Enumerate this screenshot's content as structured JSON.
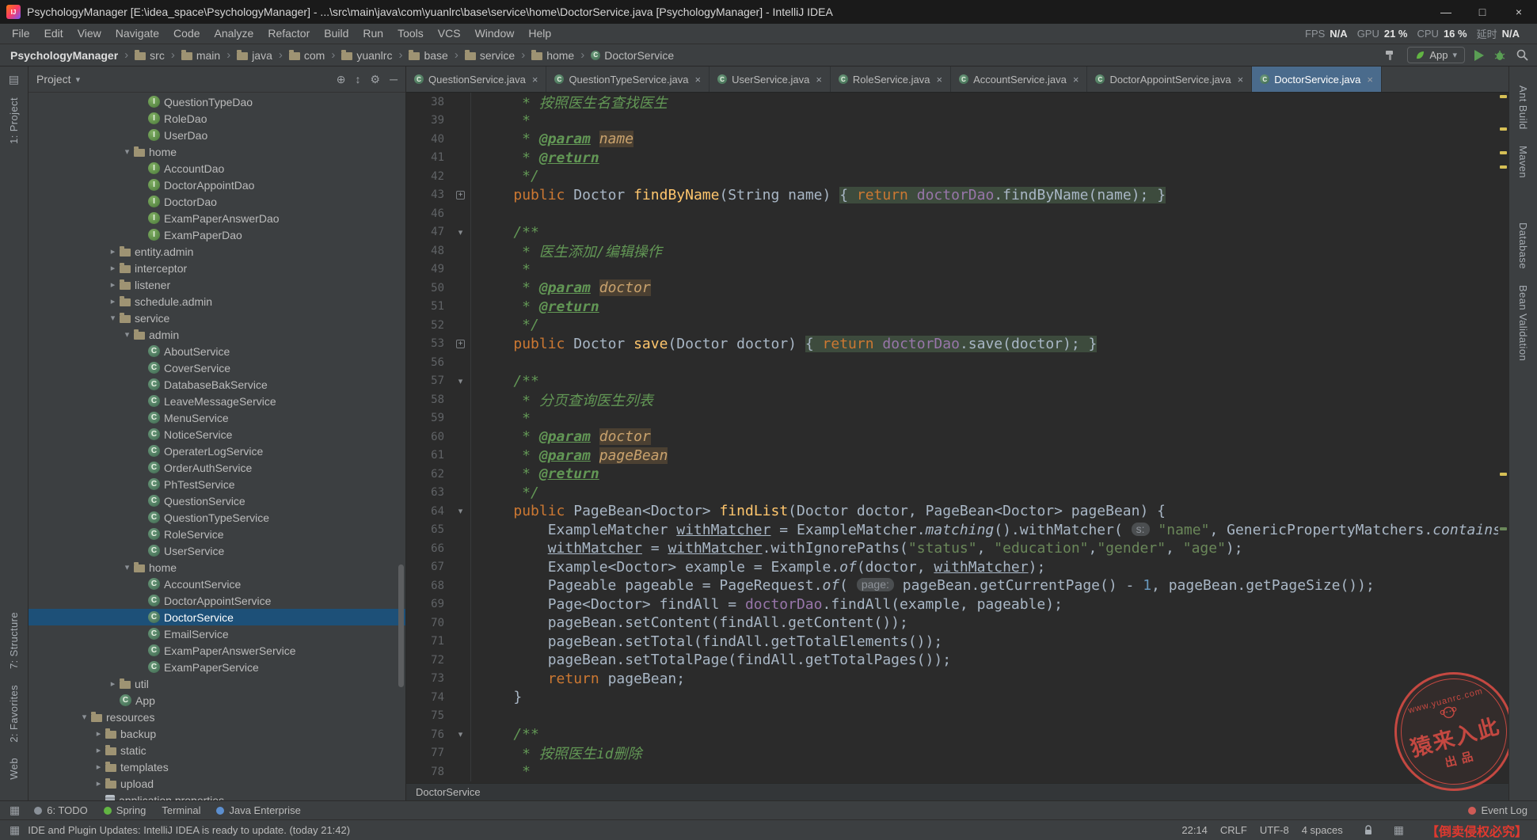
{
  "title_bar": {
    "title": "PsychologyManager [E:\\idea_space\\PsychologyManager] - ...\\src\\main\\java\\com\\yuanlrc\\base\\service\\home\\DoctorService.java [PsychologyManager] - IntelliJ IDEA",
    "window_buttons": {
      "minimize": "—",
      "maximize": "□",
      "close": "×"
    }
  },
  "menu_bar": {
    "items": [
      "File",
      "Edit",
      "View",
      "Navigate",
      "Code",
      "Analyze",
      "Refactor",
      "Build",
      "Run",
      "Tools",
      "VCS",
      "Window",
      "Help"
    ],
    "perf_stats": [
      {
        "label": "FPS",
        "value": "N/A"
      },
      {
        "label": "GPU",
        "value": "21 %"
      },
      {
        "label": "CPU",
        "value": "16 %"
      },
      {
        "label": "延时",
        "value": "N/A"
      }
    ]
  },
  "nav_bar": {
    "crumbs": [
      {
        "label": "PsychologyManager",
        "icon": "project"
      },
      {
        "label": "src",
        "icon": "folder"
      },
      {
        "label": "main",
        "icon": "folder"
      },
      {
        "label": "java",
        "icon": "folder"
      },
      {
        "label": "com",
        "icon": "folder"
      },
      {
        "label": "yuanlrc",
        "icon": "folder"
      },
      {
        "label": "base",
        "icon": "folder"
      },
      {
        "label": "service",
        "icon": "folder"
      },
      {
        "label": "home",
        "icon": "folder"
      },
      {
        "label": "DoctorService",
        "icon": "class"
      }
    ],
    "run_config": "App"
  },
  "left_stripe": {
    "top": [
      "1: Project"
    ],
    "bottom": [
      "7: Structure",
      "2: Favorites",
      "Web"
    ]
  },
  "right_stripe": {
    "groups": [
      [
        "Ant Build",
        "Maven"
      ],
      [
        "Database",
        "Bean Validation"
      ]
    ]
  },
  "project": {
    "header": "Project",
    "tree": [
      {
        "label": "QuestionTypeDao",
        "level": 7,
        "icon": "interface",
        "state": "leaf"
      },
      {
        "label": "RoleDao",
        "level": 7,
        "icon": "interface",
        "state": "leaf"
      },
      {
        "label": "UserDao",
        "level": 7,
        "icon": "interface",
        "state": "leaf"
      },
      {
        "label": "home",
        "level": 6,
        "icon": "folder",
        "state": "open"
      },
      {
        "label": "AccountDao",
        "level": 7,
        "icon": "interface",
        "state": "leaf"
      },
      {
        "label": "DoctorAppointDao",
        "level": 7,
        "icon": "interface",
        "state": "leaf"
      },
      {
        "label": "DoctorDao",
        "level": 7,
        "icon": "interface",
        "state": "leaf"
      },
      {
        "label": "ExamPaperAnswerDao",
        "level": 7,
        "icon": "interface",
        "state": "leaf"
      },
      {
        "label": "ExamPaperDao",
        "level": 7,
        "icon": "interface",
        "state": "leaf"
      },
      {
        "label": "entity.admin",
        "level": 5,
        "icon": "folder",
        "state": "closed"
      },
      {
        "label": "interceptor",
        "level": 5,
        "icon": "folder",
        "state": "closed"
      },
      {
        "label": "listener",
        "level": 5,
        "icon": "folder",
        "state": "closed"
      },
      {
        "label": "schedule.admin",
        "level": 5,
        "icon": "folder",
        "state": "closed"
      },
      {
        "label": "service",
        "level": 5,
        "icon": "folder",
        "state": "open"
      },
      {
        "label": "admin",
        "level": 6,
        "icon": "folder",
        "state": "open"
      },
      {
        "label": "AboutService",
        "level": 7,
        "icon": "class",
        "state": "leaf"
      },
      {
        "label": "CoverService",
        "level": 7,
        "icon": "class",
        "state": "leaf"
      },
      {
        "label": "DatabaseBakService",
        "level": 7,
        "icon": "class",
        "state": "leaf"
      },
      {
        "label": "LeaveMessageService",
        "level": 7,
        "icon": "class",
        "state": "leaf"
      },
      {
        "label": "MenuService",
        "level": 7,
        "icon": "class",
        "state": "leaf"
      },
      {
        "label": "NoticeService",
        "level": 7,
        "icon": "class",
        "state": "leaf"
      },
      {
        "label": "OperaterLogService",
        "level": 7,
        "icon": "class",
        "state": "leaf"
      },
      {
        "label": "OrderAuthService",
        "level": 7,
        "icon": "class",
        "state": "leaf"
      },
      {
        "label": "PhTestService",
        "level": 7,
        "icon": "class",
        "state": "leaf"
      },
      {
        "label": "QuestionService",
        "level": 7,
        "icon": "class",
        "state": "leaf"
      },
      {
        "label": "QuestionTypeService",
        "level": 7,
        "icon": "class",
        "state": "leaf"
      },
      {
        "label": "RoleService",
        "level": 7,
        "icon": "class",
        "state": "leaf"
      },
      {
        "label": "UserService",
        "level": 7,
        "icon": "class",
        "state": "leaf"
      },
      {
        "label": "home",
        "level": 6,
        "icon": "folder",
        "state": "open"
      },
      {
        "label": "AccountService",
        "level": 7,
        "icon": "class",
        "state": "leaf"
      },
      {
        "label": "DoctorAppointService",
        "level": 7,
        "icon": "class",
        "state": "leaf"
      },
      {
        "label": "DoctorService",
        "level": 7,
        "icon": "class",
        "state": "leaf",
        "selected": true
      },
      {
        "label": "EmailService",
        "level": 7,
        "icon": "class",
        "state": "leaf"
      },
      {
        "label": "ExamPaperAnswerService",
        "level": 7,
        "icon": "class",
        "state": "leaf"
      },
      {
        "label": "ExamPaperService",
        "level": 7,
        "icon": "class",
        "state": "leaf"
      },
      {
        "label": "util",
        "level": 5,
        "icon": "folder",
        "state": "closed"
      },
      {
        "label": "App",
        "level": 5,
        "icon": "class",
        "state": "leaf"
      },
      {
        "label": "resources",
        "level": 3,
        "icon": "folder",
        "state": "open"
      },
      {
        "label": "backup",
        "level": 4,
        "icon": "folder",
        "state": "closed"
      },
      {
        "label": "static",
        "level": 4,
        "icon": "folder",
        "state": "closed"
      },
      {
        "label": "templates",
        "level": 4,
        "icon": "folder",
        "state": "closed"
      },
      {
        "label": "upload",
        "level": 4,
        "icon": "folder",
        "state": "closed"
      },
      {
        "label": "application.properties",
        "level": 4,
        "icon": "props",
        "state": "leaf"
      }
    ]
  },
  "editor": {
    "tabs": [
      {
        "label": "QuestionService.java"
      },
      {
        "label": "QuestionTypeService.java"
      },
      {
        "label": "UserService.java"
      },
      {
        "label": "RoleService.java"
      },
      {
        "label": "AccountService.java"
      },
      {
        "label": "DoctorAppointService.java"
      },
      {
        "label": "DoctorService.java",
        "active": true
      }
    ],
    "breadcrumb": "DoctorService",
    "stripe_marks": [
      {
        "p": 0.004,
        "c": "#d6bf55"
      },
      {
        "p": 0.05,
        "c": "#d6bf55"
      },
      {
        "p": 0.085,
        "c": "#d6bf55"
      },
      {
        "p": 0.105,
        "c": "#d6bf55"
      },
      {
        "p": 0.55,
        "c": "#d6bf55"
      },
      {
        "p": 0.63,
        "c": "#6a8759"
      }
    ],
    "lines": [
      {
        "n": 38,
        "tokens": [
          [
            "c",
            "     * 按照医生名查找医生"
          ]
        ]
      },
      {
        "n": 39,
        "tokens": [
          [
            "c",
            "     *"
          ]
        ]
      },
      {
        "n": 40,
        "tokens": [
          [
            "c",
            "     * "
          ],
          [
            "t",
            "@param"
          ],
          [
            "c",
            " "
          ],
          [
            "pv",
            "name"
          ]
        ]
      },
      {
        "n": 41,
        "tokens": [
          [
            "c",
            "     * "
          ],
          [
            "t",
            "@return"
          ]
        ]
      },
      {
        "n": 42,
        "tokens": [
          [
            "c",
            "     */"
          ]
        ]
      },
      {
        "n": 43,
        "fold": "closed",
        "tokens": [
          [
            "d",
            "    "
          ],
          [
            "k",
            "public"
          ],
          [
            "d",
            " Doctor "
          ],
          [
            "m",
            "findByName"
          ],
          [
            "d",
            "(String name) "
          ],
          [
            "d fold",
            "{ "
          ],
          [
            "k fold",
            "return"
          ],
          [
            "d fold",
            " "
          ],
          [
            "f fold",
            "doctorDao"
          ],
          [
            "d fold",
            ".findByName(name); }"
          ]
        ]
      },
      {
        "n": 46,
        "tokens": []
      },
      {
        "n": 47,
        "fold": "open",
        "tokens": [
          [
            "c",
            "    /**"
          ]
        ]
      },
      {
        "n": 48,
        "tokens": [
          [
            "c",
            "     * 医生添加/编辑操作"
          ]
        ]
      },
      {
        "n": 49,
        "tokens": [
          [
            "c",
            "     *"
          ]
        ]
      },
      {
        "n": 50,
        "tokens": [
          [
            "c",
            "     * "
          ],
          [
            "t",
            "@param"
          ],
          [
            "c",
            " "
          ],
          [
            "pv",
            "doctor"
          ]
        ]
      },
      {
        "n": 51,
        "tokens": [
          [
            "c",
            "     * "
          ],
          [
            "t",
            "@return"
          ]
        ]
      },
      {
        "n": 52,
        "tokens": [
          [
            "c",
            "     */"
          ]
        ]
      },
      {
        "n": 53,
        "fold": "closed",
        "tokens": [
          [
            "d",
            "    "
          ],
          [
            "k",
            "public"
          ],
          [
            "d",
            " Doctor "
          ],
          [
            "m",
            "save"
          ],
          [
            "d",
            "(Doctor doctor) "
          ],
          [
            "d fold",
            "{ "
          ],
          [
            "k fold",
            "return"
          ],
          [
            "d fold",
            " "
          ],
          [
            "f fold",
            "doctorDao"
          ],
          [
            "d fold",
            ".save(doctor); }"
          ]
        ]
      },
      {
        "n": 56,
        "tokens": []
      },
      {
        "n": 57,
        "fold": "open",
        "tokens": [
          [
            "c",
            "    /**"
          ]
        ]
      },
      {
        "n": 58,
        "tokens": [
          [
            "c",
            "     * 分页查询医生列表"
          ]
        ]
      },
      {
        "n": 59,
        "tokens": [
          [
            "c",
            "     *"
          ]
        ]
      },
      {
        "n": 60,
        "tokens": [
          [
            "c",
            "     * "
          ],
          [
            "t",
            "@param"
          ],
          [
            "c",
            " "
          ],
          [
            "pv",
            "doctor"
          ]
        ]
      },
      {
        "n": 61,
        "tokens": [
          [
            "c",
            "     * "
          ],
          [
            "t",
            "@param"
          ],
          [
            "c",
            " "
          ],
          [
            "pv",
            "pageBean"
          ]
        ]
      },
      {
        "n": 62,
        "tokens": [
          [
            "c",
            "     * "
          ],
          [
            "t",
            "@return"
          ]
        ]
      },
      {
        "n": 63,
        "tokens": [
          [
            "c",
            "     */"
          ]
        ]
      },
      {
        "n": 64,
        "fold": "open",
        "tokens": [
          [
            "d",
            "    "
          ],
          [
            "k",
            "public"
          ],
          [
            "d",
            " PageBean<Doctor> "
          ],
          [
            "m",
            "findList"
          ],
          [
            "d",
            "(Doctor doctor, PageBean<Doctor> pageBean) {"
          ]
        ]
      },
      {
        "n": 65,
        "tokens": [
          [
            "d",
            "        ExampleMatcher "
          ],
          [
            "u",
            "withMatcher"
          ],
          [
            "d",
            " = ExampleMatcher."
          ],
          [
            "im",
            "matching"
          ],
          [
            "d",
            "()."
          ],
          [
            "d",
            "withMatcher"
          ],
          [
            "d",
            "( "
          ],
          [
            "h",
            "s:"
          ],
          [
            "d",
            " "
          ],
          [
            "s",
            "\"name\""
          ],
          [
            "d",
            ", GenericPropertyMatchers."
          ],
          [
            "im",
            "contains"
          ],
          [
            "d",
            "("
          ]
        ]
      },
      {
        "n": 66,
        "tokens": [
          [
            "d",
            "        "
          ],
          [
            "u",
            "withMatcher"
          ],
          [
            "d",
            " = "
          ],
          [
            "u",
            "withMatcher"
          ],
          [
            "d",
            ".withIgnorePaths("
          ],
          [
            "s",
            "\"status\""
          ],
          [
            "d",
            ", "
          ],
          [
            "s",
            "\"education\""
          ],
          [
            "d",
            ","
          ],
          [
            "s",
            "\"gender\""
          ],
          [
            "d",
            ", "
          ],
          [
            "s",
            "\"age\""
          ],
          [
            "d",
            ");"
          ]
        ]
      },
      {
        "n": 67,
        "tokens": [
          [
            "d",
            "        Example<Doctor> example = Example."
          ],
          [
            "im",
            "of"
          ],
          [
            "d",
            "(doctor, "
          ],
          [
            "u",
            "withMatcher"
          ],
          [
            "d",
            ");"
          ]
        ]
      },
      {
        "n": 68,
        "tokens": [
          [
            "d",
            "        Pageable pageable = PageRequest."
          ],
          [
            "im",
            "of"
          ],
          [
            "d",
            "( "
          ],
          [
            "h",
            "page:"
          ],
          [
            "d",
            " pageBean.getCurrentPage() - "
          ],
          [
            "n2",
            "1"
          ],
          [
            "d",
            ", pageBean.getPageSize());"
          ]
        ]
      },
      {
        "n": 69,
        "tokens": [
          [
            "d",
            "        Page<Doctor> findAll = "
          ],
          [
            "f",
            "doctorDao"
          ],
          [
            "d",
            ".findAll(example, pageable);"
          ]
        ]
      },
      {
        "n": 70,
        "tokens": [
          [
            "d",
            "        pageBean.setContent(findAll.getContent());"
          ]
        ]
      },
      {
        "n": 71,
        "tokens": [
          [
            "d",
            "        pageBean.setTotal(findAll.getTotalElements());"
          ]
        ]
      },
      {
        "n": 72,
        "tokens": [
          [
            "d",
            "        pageBean.setTotalPage(findAll.getTotalPages());"
          ]
        ]
      },
      {
        "n": 73,
        "tokens": [
          [
            "d",
            "        "
          ],
          [
            "k",
            "return"
          ],
          [
            "d",
            " pageBean;"
          ]
        ]
      },
      {
        "n": 74,
        "tokens": [
          [
            "d",
            "    }"
          ]
        ]
      },
      {
        "n": 75,
        "tokens": []
      },
      {
        "n": 76,
        "fold": "open",
        "tokens": [
          [
            "c",
            "    /**"
          ]
        ]
      },
      {
        "n": 77,
        "tokens": [
          [
            "c",
            "     * 按照医生id删除"
          ]
        ]
      },
      {
        "n": 78,
        "tokens": [
          [
            "c",
            "     *"
          ]
        ]
      }
    ]
  },
  "bottom_bar": {
    "left": [
      {
        "label": "6: TODO",
        "icon": "todo"
      },
      {
        "label": "Spring",
        "icon": "spring-leaf"
      },
      {
        "label": "Terminal",
        "icon": null
      },
      {
        "label": "Java Enterprise",
        "icon": "java"
      }
    ],
    "right": [
      {
        "label": "Event Log",
        "icon": "balloon"
      }
    ]
  },
  "status_bar": {
    "message": "IDE and Plugin Updates: IntelliJ IDEA is ready to update. (today 21:42)",
    "right_items": [
      "22:14",
      "CRLF",
      "UTF-8",
      "4 spaces"
    ],
    "watermark_text": "【倒卖侵权必究】"
  },
  "watermark": {
    "site": "www.yuanrc.com",
    "main": "猿来入此",
    "sub": "出品"
  },
  "colors": {
    "accent": "#4a88c7",
    "tree_selection": "#1d5078",
    "active_tab": "#4a6b8c",
    "keyword": "#cc7832",
    "string": "#6a8759",
    "comment": "#629755",
    "stamp_red": "#d24b43"
  }
}
